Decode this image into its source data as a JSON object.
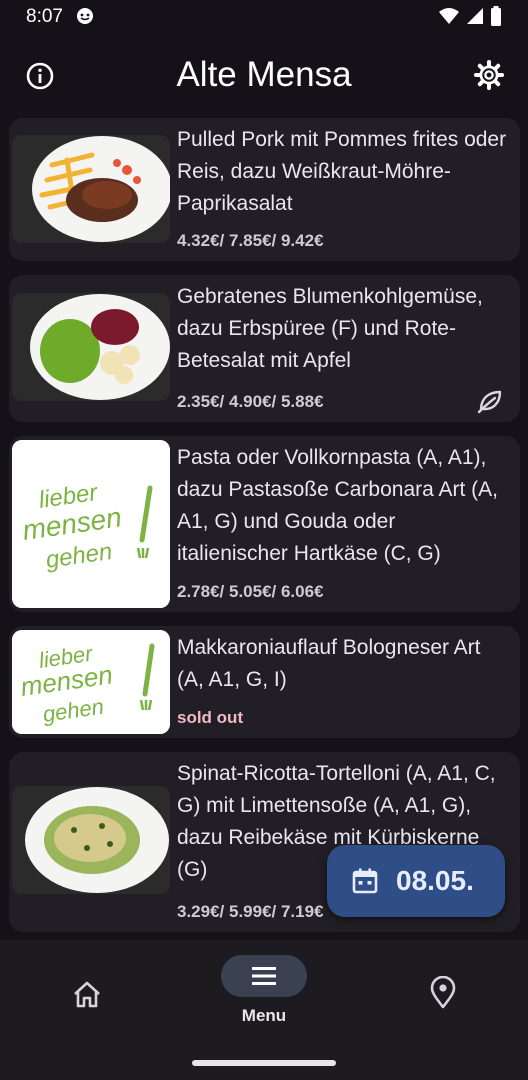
{
  "status": {
    "time": "8:07"
  },
  "header": {
    "title": "Alte Mensa"
  },
  "meals": [
    {
      "name": "Pulled Pork mit Pommes frites oder Reis, dazu Weißkraut-Möhre-Paprikasalat",
      "price": "4.32€/ 7.85€/ 9.42€"
    },
    {
      "name": "Gebratenes Blumenkohlgemüse, dazu Erbspüree (F) und Rote-Betesalat mit Apfel",
      "price": "2.35€/ 4.90€/ 5.88€",
      "vegan": true
    },
    {
      "name": "Pasta oder Vollkornpasta (A, A1), dazu Pastasoße Carbonara Art (A, A1, G) und Gouda oder italienischer Hartkäse (C, G)",
      "price": "2.78€/ 5.05€/ 6.06€",
      "placeholder_logo": "lieber mensen gehen"
    },
    {
      "name": "Makkaroniauflauf Bologneser Art (A, A1, G, I)",
      "price": "sold out",
      "placeholder_logo": "lieber mensen gehen"
    },
    {
      "name": "Spinat-Ricotta-Tortelloni (A, A1, C, G) mit Limettensoße (A, A1, G), dazu Reibekäse mit Kürbiskerne (G)",
      "price": "3.29€/ 5.99€/ 7.19€"
    }
  ],
  "date_button": {
    "label": "08.05."
  },
  "bottom_nav": {
    "menu_label": "Menu"
  },
  "colors": {
    "background": "#141218",
    "card": "#211f25",
    "fab": "#2f4d86",
    "logo_green": "#7cb342"
  }
}
